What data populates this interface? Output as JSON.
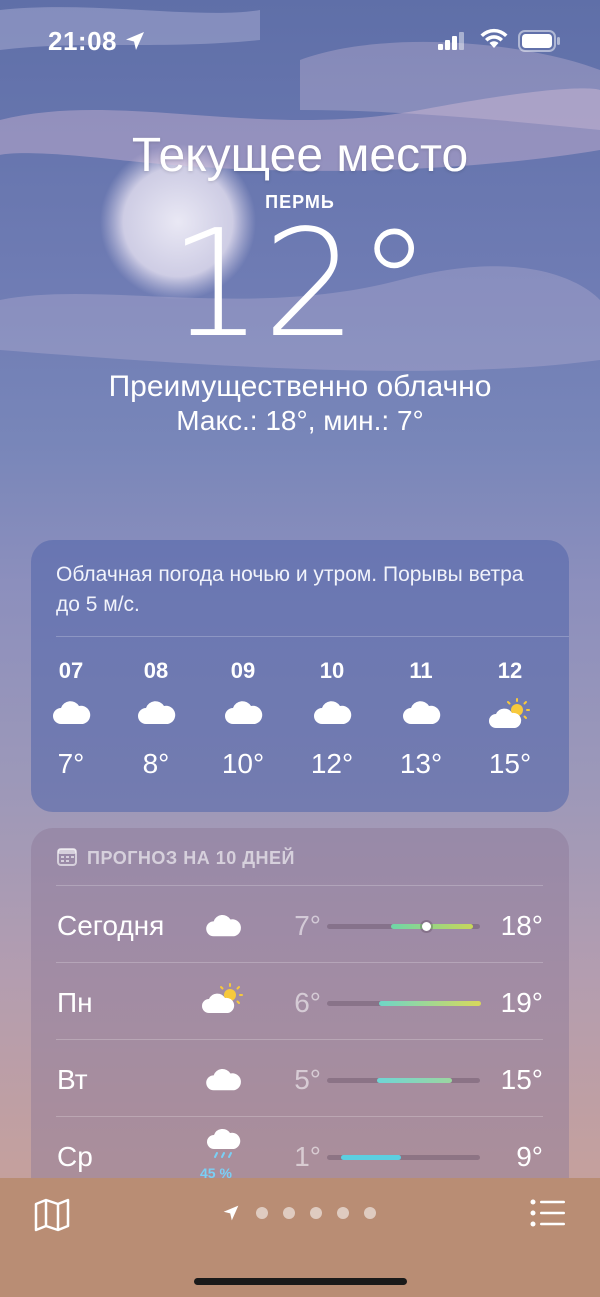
{
  "status": {
    "time": "21:08"
  },
  "header": {
    "title": "Текущее место",
    "city": "ПЕРМЬ",
    "temperature": "12°",
    "condition": "Преимущественно облачно",
    "hilo": "Макс.: 18°, мин.: 7°"
  },
  "hourly": {
    "summary": "Облачная погода ночью и утром. Порывы ветра до 5 м/с.",
    "items": [
      {
        "hour": "07",
        "icon": "cloud-icon",
        "temp": "7°"
      },
      {
        "hour": "08",
        "icon": "cloud-icon",
        "temp": "8°"
      },
      {
        "hour": "09",
        "icon": "cloud-icon",
        "temp": "10°"
      },
      {
        "hour": "10",
        "icon": "cloud-icon",
        "temp": "12°"
      },
      {
        "hour": "11",
        "icon": "cloud-icon",
        "temp": "13°"
      },
      {
        "hour": "12",
        "icon": "partly-sunny-icon",
        "temp": "15°"
      }
    ]
  },
  "daily": {
    "heading": "ПРОГНОЗ НА 10 ДНЕЙ",
    "days": [
      {
        "day": "Сегодня",
        "icon": "cloud-icon",
        "low": "7°",
        "high": "18°",
        "current_marker": true
      },
      {
        "day": "Пн",
        "icon": "partly-sunny-icon",
        "low": "6°",
        "high": "19°"
      },
      {
        "day": "Вт",
        "icon": "cloud-icon",
        "low": "5°",
        "high": "15°"
      },
      {
        "day": "Ср",
        "icon": "rain-icon",
        "low": "1°",
        "high": "9°",
        "precip": "45 %"
      }
    ]
  },
  "bottom": {
    "pages": 5,
    "active_page_icon": "location-arrow-icon"
  },
  "colors": {
    "sun": "#f7c93c",
    "rain": "#7ad0f5",
    "bar_cool": "#6ed6c8",
    "bar_warm": "#c7d65a"
  }
}
